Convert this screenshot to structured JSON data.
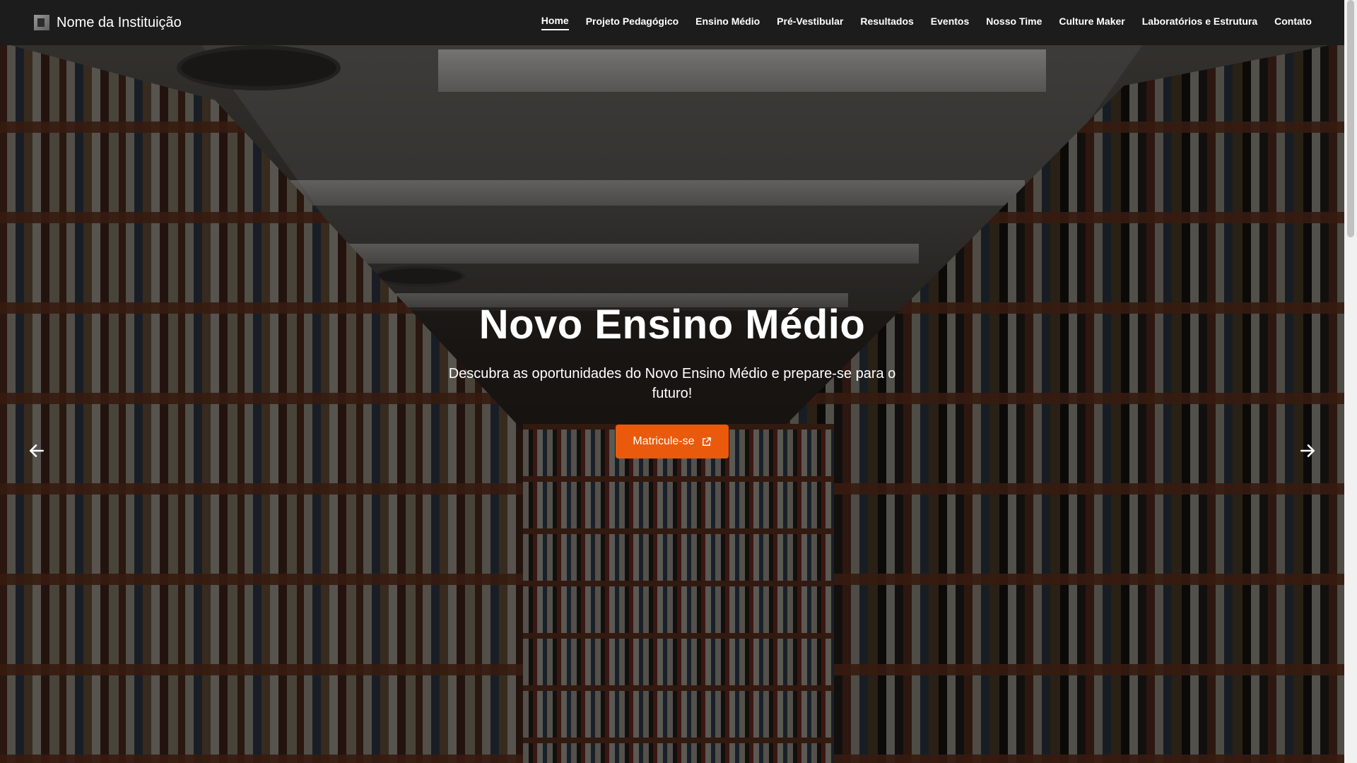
{
  "navbar": {
    "brand": "Nome da Instituição",
    "links": [
      {
        "label": "Home",
        "active": true
      },
      {
        "label": "Projeto Pedagógico"
      },
      {
        "label": "Ensino Médio"
      },
      {
        "label": "Pré-Vestibular"
      },
      {
        "label": "Resultados"
      },
      {
        "label": "Eventos"
      },
      {
        "label": "Nosso Time"
      },
      {
        "label": "Culture Maker"
      },
      {
        "label": "Laboratórios e Estrutura"
      },
      {
        "label": "Contato"
      }
    ]
  },
  "hero": {
    "title": "Novo Ensino Médio",
    "subtitle": "Descubra as oportunidades do Novo Ensino Médio e prepare-se para o futuro!",
    "cta_label": "Matricule-se",
    "cta_icon": "external-link-icon",
    "prev_icon": "arrow-left-icon",
    "next_icon": "arrow-right-icon"
  },
  "colors": {
    "navbar_bg": "#1c1c1c",
    "accent": "#ea5a0c",
    "text": "#ffffff"
  }
}
